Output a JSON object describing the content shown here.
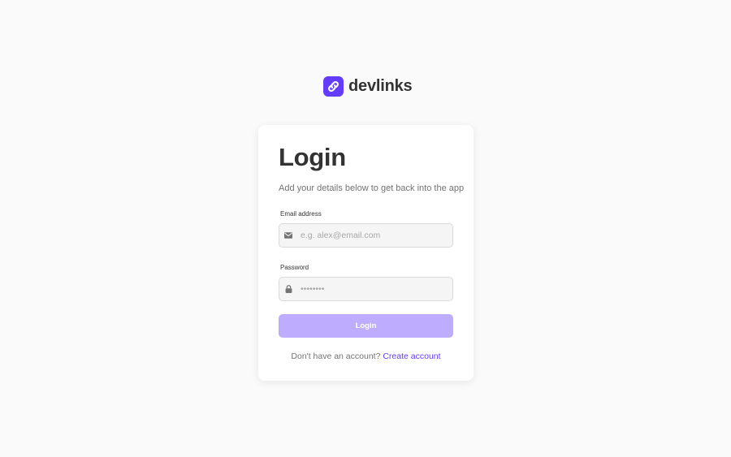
{
  "brand": {
    "name": "devlinks",
    "logo_icon": "link-icon",
    "color": "#633cff"
  },
  "login": {
    "title": "Login",
    "subtitle": "Add your details below to get back into the app",
    "email": {
      "label": "Email address",
      "placeholder": "e.g. alex@email.com",
      "value": "",
      "icon": "envelope-icon"
    },
    "password": {
      "label": "Password",
      "placeholder": "••••••••",
      "value": "",
      "icon": "lock-icon"
    },
    "button_label": "Login",
    "button_color": "#beadff",
    "footer_prompt": "Don't have an account?",
    "footer_link": "Create account",
    "link_color": "#633cff"
  }
}
